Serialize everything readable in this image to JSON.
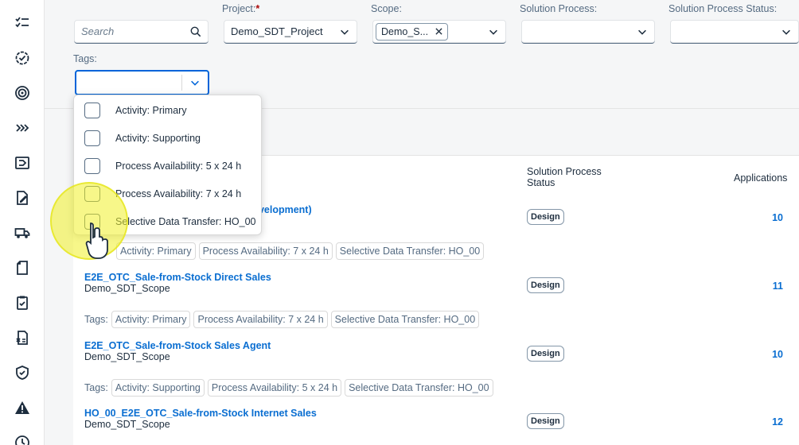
{
  "filters": {
    "search_placeholder": "Search",
    "project_label": "Project:",
    "project_required": "*",
    "project_value": "Demo_SDT_Project",
    "scope_label": "Scope:",
    "scope_token": "Demo_S...",
    "solution_process_label": "Solution Process:",
    "solution_process_status_label": "Solution Process Status:",
    "tags_label": "Tags:"
  },
  "tags_dropdown": {
    "options": [
      "Activity: Primary",
      "Activity: Supporting",
      "Process Availability: 5 x 24 h",
      "Process Availability: 7 x 24 h",
      "Selective Data Transfer: HO_00"
    ]
  },
  "table": {
    "col_status_line1": "Solution Process",
    "col_status_line2": "Status",
    "col_applications": "Applications",
    "tags_prefix": "Tags:",
    "rows": [
      {
        "title_partial": "evelopment)",
        "status": "Design",
        "apps": "10",
        "tags": [
          "Activity: Primary",
          "Process Availability: 7 x 24 h",
          "Selective Data Transfer: HO_00"
        ]
      },
      {
        "title": "E2E_OTC_Sale-from-Stock Direct Sales",
        "scope": "Demo_SDT_Scope",
        "status": "Design",
        "apps": "11",
        "tags": [
          "Activity: Primary",
          "Process Availability: 7 x 24 h",
          "Selective Data Transfer: HO_00"
        ]
      },
      {
        "title": "E2E_OTC_Sale-from-Stock Sales Agent",
        "scope": "Demo_SDT_Scope",
        "status": "Design",
        "apps": "10",
        "tags": [
          "Activity: Supporting",
          "Process Availability: 5 x 24 h",
          "Selective Data Transfer: HO_00"
        ]
      },
      {
        "title": "HO_00_E2E_OTC_Sale-from-Stock Internet Sales",
        "scope": "Demo_SDT_Scope",
        "status": "Design",
        "apps": "12"
      }
    ]
  },
  "rail_icons": [
    "task-list-icon",
    "gear-check-icon",
    "target-icon",
    "chevrons-right-icon",
    "exit-box-icon",
    "edit-document-icon",
    "truck-icon",
    "document-icon",
    "clipboard-check-icon",
    "document-x-icon",
    "shield-check-icon",
    "warning-icon",
    "clock-icon"
  ],
  "colors": {
    "accent": "#0a6ed1",
    "focus": "#0064d9",
    "highlight": "#f0f028"
  }
}
